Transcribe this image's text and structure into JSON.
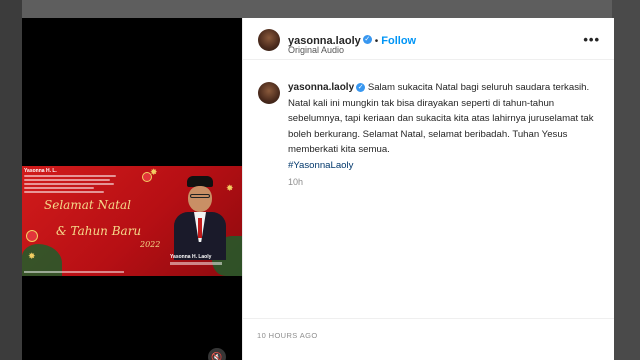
{
  "post": {
    "username": "yasonna.laoly",
    "follow_label": "Follow",
    "audio_label": "Original Audio",
    "more_label": "•••",
    "caption_text": "Salam sukacita Natal bagi seluruh saudara terkasih. Natal kali ini mungkin tak bisa dirayakan seperti di tahun-tahun sebelumnya, tapi keriaan dan sukacita kita atas lahirnya juruselamat tak boleh berkurang. Selamat Natal, selamat beribadah. Tuhan Yesus memberkati kita semua.",
    "hashtag": "#YasonnaLaoly",
    "time_ago": "10h",
    "post_date": "10 HOURS AGO"
  },
  "card": {
    "top_label": "Yasonna H. L.",
    "greeting_line1": "Selamat Natal",
    "greeting_line2": "& Tahun Baru",
    "year": "2022",
    "person_name": "Yasonna H. Laoly"
  },
  "colors": {
    "accent": "#0095f6",
    "card_red": "#c4141a",
    "gold": "#f5d98a"
  },
  "icons": {
    "verified": "verified-badge-icon",
    "more": "more-options-icon"
  }
}
